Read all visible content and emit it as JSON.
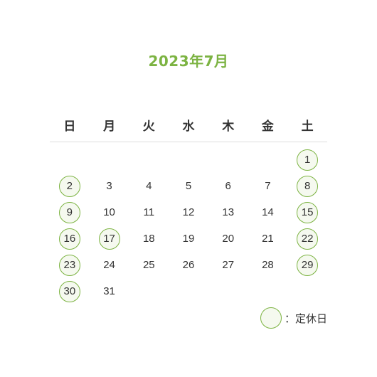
{
  "calendar": {
    "title": "2023年7月",
    "weekdays": [
      "日",
      "月",
      "火",
      "水",
      "木",
      "金",
      "土"
    ],
    "leading_blanks": 6,
    "days": [
      {
        "day": "1",
        "holiday": true
      },
      {
        "day": "2",
        "holiday": true
      },
      {
        "day": "3",
        "holiday": false
      },
      {
        "day": "4",
        "holiday": false
      },
      {
        "day": "5",
        "holiday": false
      },
      {
        "day": "6",
        "holiday": false
      },
      {
        "day": "7",
        "holiday": false
      },
      {
        "day": "8",
        "holiday": true
      },
      {
        "day": "9",
        "holiday": true
      },
      {
        "day": "10",
        "holiday": false
      },
      {
        "day": "11",
        "holiday": false
      },
      {
        "day": "12",
        "holiday": false
      },
      {
        "day": "13",
        "holiday": false
      },
      {
        "day": "14",
        "holiday": false
      },
      {
        "day": "15",
        "holiday": true
      },
      {
        "day": "16",
        "holiday": true
      },
      {
        "day": "17",
        "holiday": true
      },
      {
        "day": "18",
        "holiday": false
      },
      {
        "day": "19",
        "holiday": false
      },
      {
        "day": "20",
        "holiday": false
      },
      {
        "day": "21",
        "holiday": false
      },
      {
        "day": "22",
        "holiday": true
      },
      {
        "day": "23",
        "holiday": true
      },
      {
        "day": "24",
        "holiday": false
      },
      {
        "day": "25",
        "holiday": false
      },
      {
        "day": "26",
        "holiday": false
      },
      {
        "day": "27",
        "holiday": false
      },
      {
        "day": "28",
        "holiday": false
      },
      {
        "day": "29",
        "holiday": true
      },
      {
        "day": "30",
        "holiday": true
      },
      {
        "day": "31",
        "holiday": false
      }
    ]
  },
  "legend": {
    "label": "：定休日"
  },
  "colors": {
    "accent": "#7cb342",
    "text": "#333333",
    "divider": "#dddddd",
    "holiday_fill": "#f5f9ef"
  }
}
